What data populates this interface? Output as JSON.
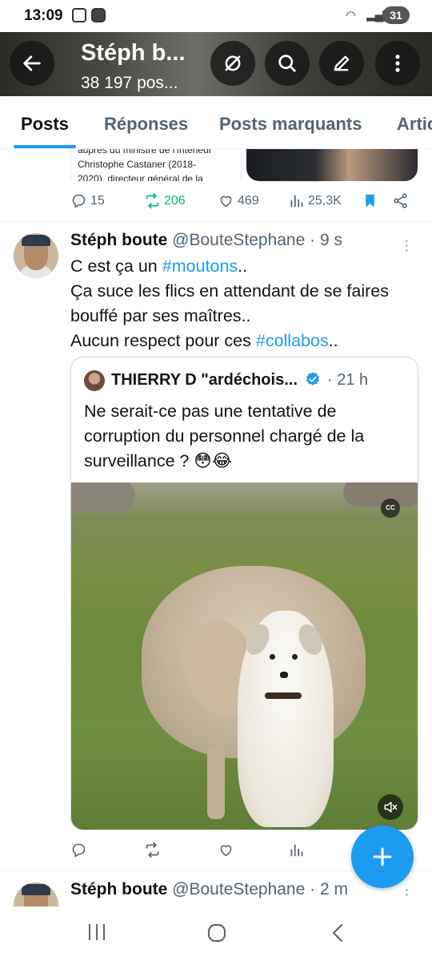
{
  "status": {
    "time": "13:09",
    "battery": "31"
  },
  "header": {
    "title": "Stéph b...",
    "subtitle": "38 197 pos..."
  },
  "tabs": [
    "Posts",
    "Réponses",
    "Posts marquants",
    "Artic"
  ],
  "prev_post": {
    "doc_lines": [
      "auprès du ministre de l'Intérieur",
      "Christophe Castaner (2018-",
      "2020), directeur général de la"
    ],
    "replies": "15",
    "reposts": "206",
    "likes": "469",
    "views": "25,3K"
  },
  "post": {
    "name": "Stéph boute",
    "handle": "@BouteStephane",
    "time": "· 9 s",
    "text_line1_pre": "C est ça un ",
    "hashtag1": "#moutons",
    "text_line1_post": "..",
    "text_line2": "Ça suce les flics en attendant de se faires",
    "text_line3": "bouffé par ses maîtres..",
    "text_line4_pre": "Aucun respect pour ces ",
    "hashtag2": "#collabos",
    "text_line4_post": "..",
    "quote": {
      "name": "THIERRY D \"ardéchois...",
      "time": "· 21 h",
      "text": "Ne serait-ce pas une tentative de corruption du personnel chargé de la surveillance ? 😳😂",
      "cc_label": "CC"
    }
  },
  "next_post": {
    "name": "Stéph boute",
    "handle": "@BouteStephane",
    "time": "· 2 m"
  },
  "colors": {
    "accent": "#1d9bf0",
    "repost": "#00ba7c",
    "text": "#0f1419",
    "muted": "#536471"
  }
}
